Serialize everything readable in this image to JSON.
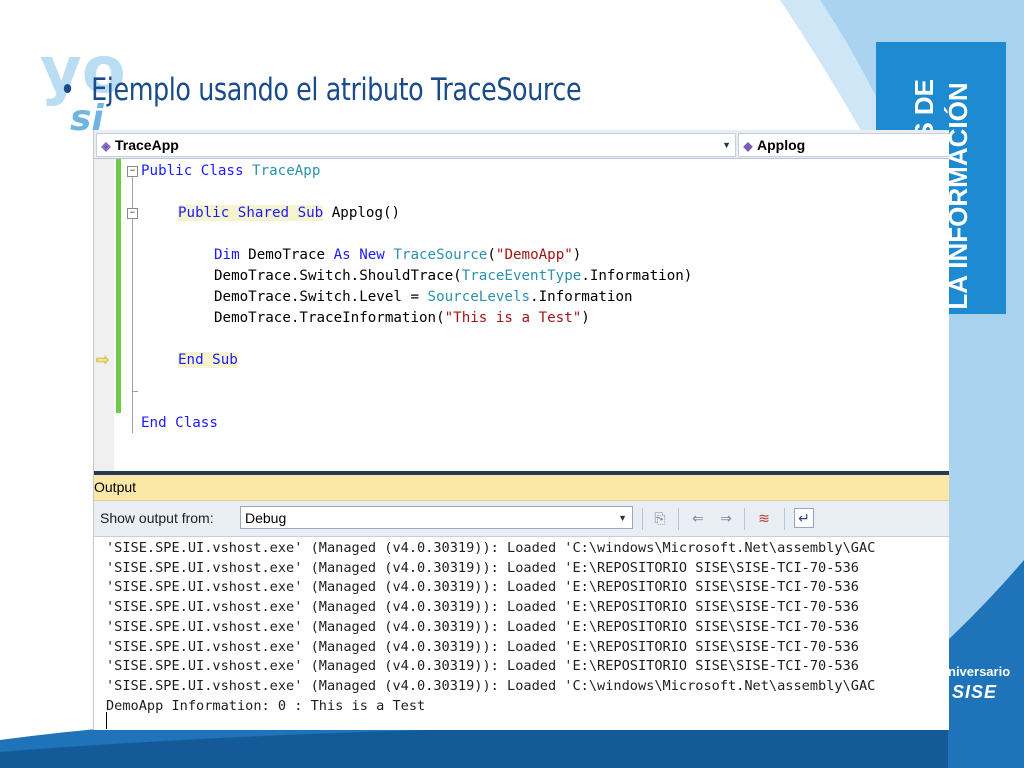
{
  "slide": {
    "bullet": "•",
    "title": "Ejemplo usando el atributo TraceSource",
    "banner_text": "TECNOLOGÍAS DE LA INFORMACIÓN",
    "brand_line1": "niversario",
    "brand_line2": "SISE"
  },
  "editor": {
    "class_dropdown": "TraceApp",
    "method_dropdown": "Applog",
    "code": {
      "l1_kw": "Public Class ",
      "l1_ty": "TraceApp",
      "l2_kw": "Public Shared Sub",
      "l2_rest": " Applog()",
      "l3_kw1": "Dim",
      "l3_mid": " DemoTrace ",
      "l3_kw2": "As New",
      "l3_sp": " ",
      "l3_ty": "TraceSource",
      "l3_p1": "(",
      "l3_st": "\"DemoApp\"",
      "l3_p2": ")",
      "l4_a": "DemoTrace.Switch.ShouldTrace(",
      "l4_ty": "TraceEventType",
      "l4_b": ".Information)",
      "l5_a": "DemoTrace.Switch.Level = ",
      "l5_ty": "SourceLevels",
      "l5_b": ".Information",
      "l6_a": "DemoTrace.TraceInformation(",
      "l6_st": "\"This is a Test\"",
      "l6_b": ")",
      "l7_kw": "End Sub",
      "l8_kw": "End Class"
    }
  },
  "output": {
    "title": "Output",
    "show_label": "Show output from:",
    "source": "Debug",
    "lines": [
      "'SISE.SPE.UI.vshost.exe' (Managed (v4.0.30319)): Loaded 'C:\\windows\\Microsoft.Net\\assembly\\GAC",
      "'SISE.SPE.UI.vshost.exe' (Managed (v4.0.30319)): Loaded 'E:\\REPOSITORIO SISE\\SISE-TCI-70-536",
      "'SISE.SPE.UI.vshost.exe' (Managed (v4.0.30319)): Loaded 'E:\\REPOSITORIO SISE\\SISE-TCI-70-536",
      "'SISE.SPE.UI.vshost.exe' (Managed (v4.0.30319)): Loaded 'E:\\REPOSITORIO SISE\\SISE-TCI-70-536",
      "'SISE.SPE.UI.vshost.exe' (Managed (v4.0.30319)): Loaded 'E:\\REPOSITORIO SISE\\SISE-TCI-70-536",
      "'SISE.SPE.UI.vshost.exe' (Managed (v4.0.30319)): Loaded 'E:\\REPOSITORIO SISE\\SISE-TCI-70-536",
      "'SISE.SPE.UI.vshost.exe' (Managed (v4.0.30319)): Loaded 'E:\\REPOSITORIO SISE\\SISE-TCI-70-536",
      "'SISE.SPE.UI.vshost.exe' (Managed (v4.0.30319)): Loaded 'C:\\windows\\Microsoft.Net\\assembly\\GAC",
      "DemoApp Information: 0 : This is a Test"
    ]
  },
  "colors": {
    "title": "#1a4c8c",
    "banner": "#1d8ad2",
    "keyword": "#1b1bff",
    "type": "#2b91af",
    "string": "#a31515",
    "change_bar": "#6ccc4a",
    "output_title_bg": "#fbe8a7"
  },
  "icons": [
    "class-icon",
    "method-icon",
    "execution-arrow-icon",
    "find-message-icon",
    "prev-message-icon",
    "next-message-icon",
    "clear-all-icon",
    "word-wrap-icon"
  ]
}
